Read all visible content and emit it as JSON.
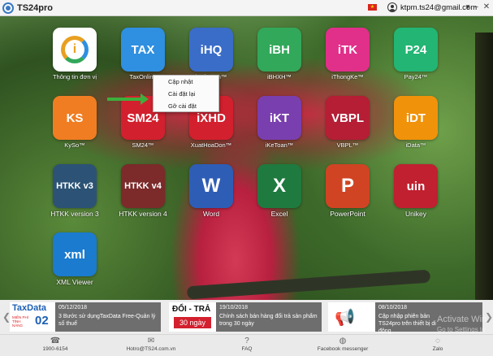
{
  "app": {
    "title": "TS24pro",
    "user_email": "ktpm.ts24@gmail.com",
    "colors": {
      "accent": "#3a78c2"
    }
  },
  "tiles": [
    {
      "id": "thongtin",
      "glyph": "i",
      "label": "Thông tin đơn vị",
      "color": "#ffffff"
    },
    {
      "id": "tax",
      "glyph": "TAX",
      "label": "TaxOnline",
      "color": "#2f8fe0"
    },
    {
      "id": "ihq",
      "glyph": "iHQ",
      "label": "iHaiQuan™",
      "color": "#3a6dc8"
    },
    {
      "id": "ibh",
      "glyph": "iBH",
      "label": "iBHXH™",
      "color": "#32a85a"
    },
    {
      "id": "itk",
      "glyph": "iTK",
      "label": "iThongKe™",
      "color": "#e0308a"
    },
    {
      "id": "p24",
      "glyph": "P24",
      "label": "Pay24™",
      "color": "#22b573"
    },
    {
      "id": "kyso",
      "glyph": "KS",
      "label": "KySo™",
      "color": "#f07d22"
    },
    {
      "id": "sm24",
      "glyph": "SM24",
      "label": "SM24™",
      "color": "#d3202e"
    },
    {
      "id": "ixhd",
      "glyph": "iXHD",
      "label": "XuatHoaDon™",
      "color": "#d3202e"
    },
    {
      "id": "ikt",
      "glyph": "iKT",
      "label": "iKeToan™",
      "color": "#7a3fae"
    },
    {
      "id": "vbpl",
      "glyph": "VBPL",
      "label": "VBPL™",
      "color": "#b51e35"
    },
    {
      "id": "idt",
      "glyph": "iDT",
      "label": "iData™",
      "color": "#f0920a"
    },
    {
      "id": "htkk3",
      "glyph": "HTKK v3",
      "label": "HTKK version 3",
      "color": "#2c5375"
    },
    {
      "id": "htkk4",
      "glyph": "HTKK v4",
      "label": "HTKK version 4",
      "color": "#7c2a2a"
    },
    {
      "id": "word",
      "glyph": "W",
      "label": "Word",
      "color": "#2e5db6"
    },
    {
      "id": "excel",
      "glyph": "X",
      "label": "Excel",
      "color": "#1f7a3f"
    },
    {
      "id": "ppt",
      "glyph": "P",
      "label": "PowerPoint",
      "color": "#d04423"
    },
    {
      "id": "unikey",
      "glyph": "uin",
      "label": "Unikey",
      "color": "#c0202f"
    },
    {
      "id": "xml",
      "glyph": "xml",
      "label": "XML Viewer",
      "color": "#1a7bcf"
    }
  ],
  "context_menu": {
    "items": [
      "Cập nhật",
      "Cài đặt lại",
      "Gỡ cài đặt"
    ]
  },
  "news": [
    {
      "banner_title": "TaxData",
      "banner_sub": "MIỄN PHÍ TÍNH NĂNG",
      "banner_num": "02",
      "date": "05/12/2018",
      "text": "3 Bước sử dụngTaxData Free-Quản lý số thuế"
    },
    {
      "banner_title": "ĐỔI - TRẢ",
      "banner_sub": "30 ngày",
      "date": "19/10/2018",
      "text": "Chính sách bán hàng đổi trả sản phẩm trong 30 ngày"
    },
    {
      "date": "08/10/2018",
      "text": "Cập nhập phiên bản TS24pro trên thiết bị di động"
    }
  ],
  "watermark": {
    "line1": "Activate Win",
    "line2": "Go to Settings to"
  },
  "footer": [
    {
      "icon": "phone-icon",
      "label": "1900-6154"
    },
    {
      "icon": "mail-icon",
      "label": "Hotro@TS24.com.vn"
    },
    {
      "icon": "help-icon",
      "label": "FAQ"
    },
    {
      "icon": "messenger-icon",
      "label": "Facebook messenger"
    },
    {
      "icon": "zalo-icon",
      "label": "Zalo"
    }
  ]
}
